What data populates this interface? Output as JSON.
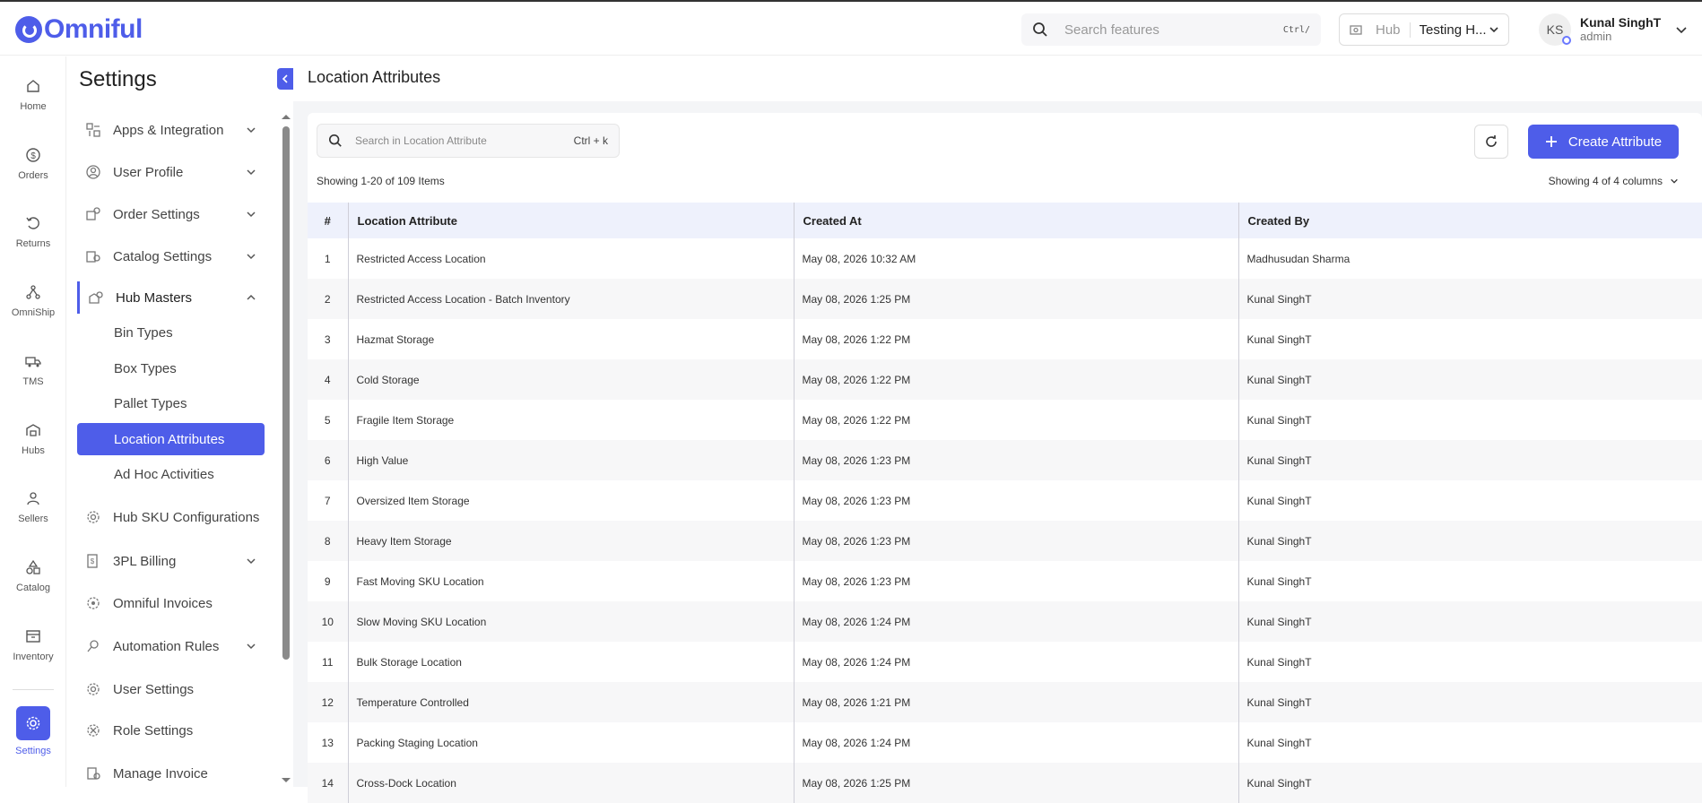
{
  "brand": {
    "name": "Omniful"
  },
  "header": {
    "search_placeholder": "Search features",
    "search_shortcut": "Ctrl/",
    "hub_label": "Hub",
    "hub_value": "Testing H...",
    "user_initials": "KS",
    "user_name": "Kunal SinghT",
    "user_role": "admin"
  },
  "rail": [
    {
      "label": "Home",
      "icon": "home-icon"
    },
    {
      "label": "Orders",
      "icon": "dollar-icon"
    },
    {
      "label": "Returns",
      "icon": "return-icon"
    },
    {
      "label": "OmniShip",
      "icon": "network-icon"
    },
    {
      "label": "TMS",
      "icon": "truck-icon"
    },
    {
      "label": "Hubs",
      "icon": "warehouse-icon"
    },
    {
      "label": "Sellers",
      "icon": "user-icon"
    },
    {
      "label": "Catalog",
      "icon": "shapes-icon"
    },
    {
      "label": "Inventory",
      "icon": "box-icon"
    },
    {
      "label": "Settings",
      "icon": "gear-icon"
    }
  ],
  "settings": {
    "title": "Settings",
    "menu": [
      {
        "label": "Apps & Integration"
      },
      {
        "label": "User Profile"
      },
      {
        "label": "Order Settings"
      },
      {
        "label": "Catalog Settings"
      },
      {
        "label": "Hub Masters"
      },
      {
        "label": "Hub SKU Configurations"
      },
      {
        "label": "3PL Billing"
      },
      {
        "label": "Omniful Invoices"
      },
      {
        "label": "Automation Rules"
      },
      {
        "label": "User Settings"
      },
      {
        "label": "Role Settings"
      },
      {
        "label": "Manage Invoice"
      }
    ],
    "submenu": [
      {
        "label": "Bin Types"
      },
      {
        "label": "Box Types"
      },
      {
        "label": "Pallet Types"
      },
      {
        "label": "Location Attributes"
      },
      {
        "label": "Ad Hoc Activities"
      }
    ]
  },
  "page": {
    "title": "Location Attributes",
    "search_placeholder": "Search in Location Attribute",
    "search_shortcut": "Ctrl + k",
    "create_label": "Create Attribute",
    "showing_items": "Showing 1-20 of 109 Items",
    "showing_columns": "Showing 4 of 4 columns"
  },
  "table": {
    "headers": [
      "#",
      "Location Attribute",
      "Created At",
      "Created By"
    ],
    "rows": [
      [
        "1",
        "Restricted Access Location",
        "May 08, 2026 10:32 AM",
        "Madhusudan Sharma"
      ],
      [
        "2",
        "Restricted Access Location - Batch Inventory",
        "May 08, 2026 1:25 PM",
        "Kunal SinghT"
      ],
      [
        "3",
        "Hazmat Storage",
        "May 08, 2026 1:22 PM",
        "Kunal SinghT"
      ],
      [
        "4",
        "Cold Storage",
        "May 08, 2026 1:22 PM",
        "Kunal SinghT"
      ],
      [
        "5",
        "Fragile Item Storage",
        "May 08, 2026 1:22 PM",
        "Kunal SinghT"
      ],
      [
        "6",
        "High Value",
        "May 08, 2026 1:23 PM",
        "Kunal SinghT"
      ],
      [
        "7",
        "Oversized Item Storage",
        "May 08, 2026 1:23 PM",
        "Kunal SinghT"
      ],
      [
        "8",
        "Heavy Item Storage",
        "May 08, 2026 1:23 PM",
        "Kunal SinghT"
      ],
      [
        "9",
        "Fast Moving SKU Location",
        "May 08, 2026 1:23 PM",
        "Kunal SinghT"
      ],
      [
        "10",
        "Slow Moving SKU Location",
        "May 08, 2026 1:24 PM",
        "Kunal SinghT"
      ],
      [
        "11",
        "Bulk Storage Location",
        "May 08, 2026 1:24 PM",
        "Kunal SinghT"
      ],
      [
        "12",
        "Temperature Controlled",
        "May 08, 2026 1:21 PM",
        "Kunal SinghT"
      ],
      [
        "13",
        "Packing Staging Location",
        "May 08, 2026 1:24 PM",
        "Kunal SinghT"
      ],
      [
        "14",
        "Cross-Dock Location",
        "May 08, 2026 1:25 PM",
        "Kunal SinghT"
      ]
    ]
  },
  "colors": {
    "accent": "#4e5de9"
  }
}
